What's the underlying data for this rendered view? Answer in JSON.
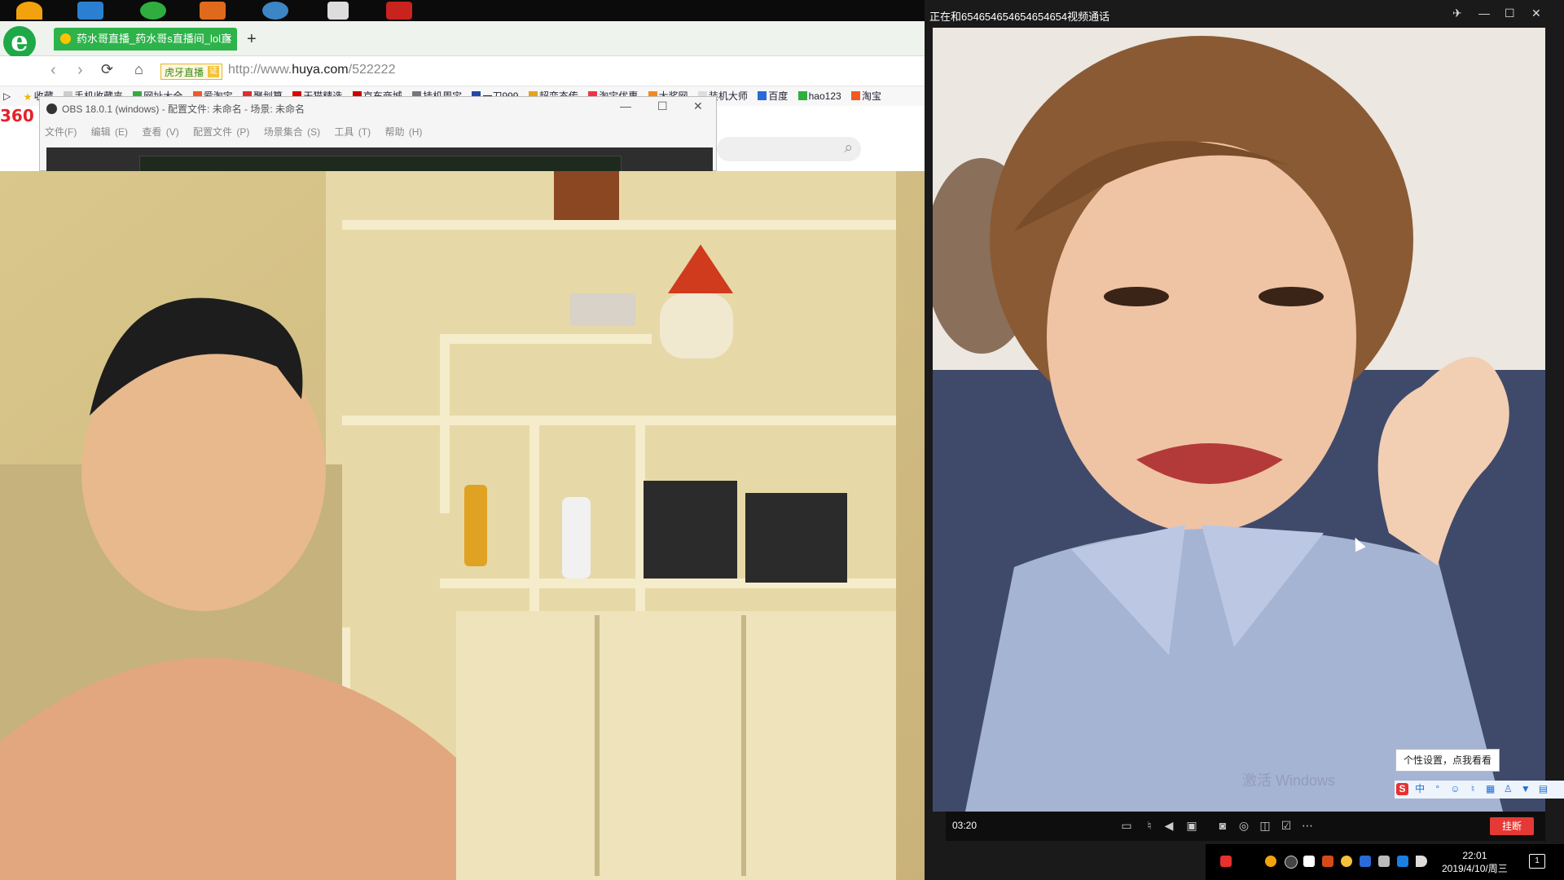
{
  "browser": {
    "tab_title": "药水哥直播_药水哥s直播间_lol直",
    "new_tab_symbol": "+",
    "badge_label": "虎牙直播",
    "badge_mark": "证",
    "url_prefix": "http://www.",
    "url_domain": "huya.com",
    "url_path": "/522222",
    "bookmarks": [
      "收藏",
      "手机收藏夹",
      "网址大全",
      "爱淘宝",
      "聚划算",
      "天猫精选",
      "京东商城",
      "挂机周宝",
      "一刀999",
      "超变态传",
      "淘宝优惠",
      "大奖网",
      "装机大师",
      "百度",
      "hao123",
      "淘宝"
    ],
    "page_logo": "360"
  },
  "obs": {
    "title": "OBS 18.0.1 (windows) - 配置文件: 未命名 - 场景: 未命名",
    "menu": [
      "文件(F)",
      "编辑 (E)",
      "查看 (V)",
      "配置文件 (P)",
      "场景集合 (S)",
      "工具 (T)",
      "帮助 (H)"
    ]
  },
  "call": {
    "title": "正在和654654654654654654视频通话",
    "timer": "03:20",
    "hangup_label": "挂断",
    "tooltip": "个性设置，点我看看",
    "watermark": "激活 Windows"
  },
  "taskbar": {
    "time": "22:01",
    "date": "2019/4/10/周三",
    "notification_count": "1"
  },
  "colors": {
    "tab_green": "#2db34a",
    "hangup_red": "#e53935",
    "call_bg": "#1a1a1a"
  }
}
